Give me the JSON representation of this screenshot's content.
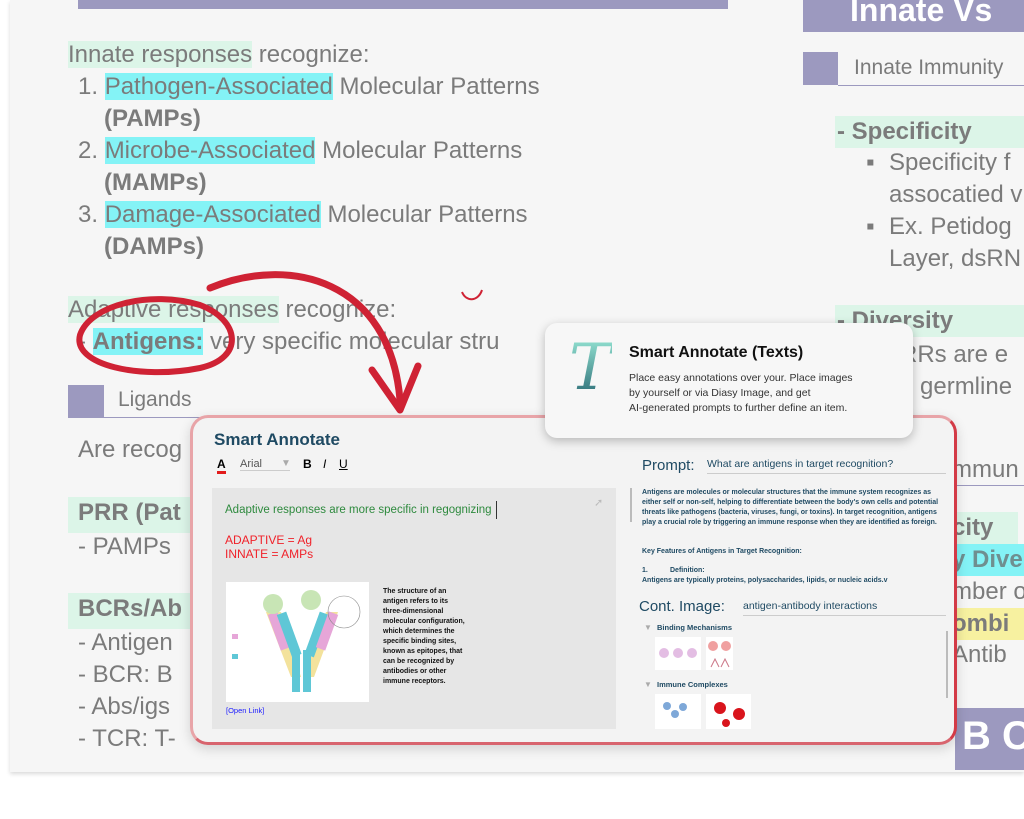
{
  "left": {
    "lines": [
      "Innate responses",
      " recognize:",
      "1. ",
      "Pathogen-Associated",
      " Molecular Patterns",
      "(PAMPs)",
      "2. ",
      "Microbe-Associated",
      " Molecular Patterns",
      "(MAMPs)",
      "3. ",
      "Damage-Associated",
      " Molecular Patterns",
      "(DAMPs)",
      "Adaptive responses",
      " recognize:",
      "-  ",
      "Antigens:",
      " very specific molecular stru"
    ],
    "ligands": "Ligands",
    "are_recog": "Are recog",
    "prr": "PRR (Pat",
    "pamps": "-  PAMPs",
    "bcrs": "BCRs/Ab",
    "items": [
      "-  Antigen",
      "-  BCR: B",
      "-  Abs/igs",
      "-  TCR: T-"
    ]
  },
  "right": {
    "title": "Innate Vs",
    "subtitle": "Innate Immunity",
    "specificity": "-  Specificity",
    "spec_lines": [
      "Specificity f",
      "assocatied v",
      "Ex. Petidog",
      "Layer, dsRN"
    ],
    "diversity": "-  Diversity",
    "div_lines": [
      "RRs are e",
      "germline",
      "mmun",
      "city",
      "y Dive",
      "mber o",
      "ombi",
      "Antib"
    ],
    "bottom": "B C"
  },
  "tooltip": {
    "title": "Smart Annotate (Texts)",
    "body": [
      "Place easy annotations over your. Place images",
      "by yourself or via Diasy Image, and get",
      "AI-generated prompts to further define an item."
    ],
    "logo_letter": "T"
  },
  "panel": {
    "title": "Smart Annotate",
    "font": "Arial",
    "bold": "B",
    "italic": "I",
    "underline": "U",
    "color_label": "A",
    "note_line": "Adaptive responses are more specific in regognizing",
    "note_red": [
      "ADAPTIVE = Ag",
      "INNATE = AMPs"
    ],
    "caption": [
      "The structure of an",
      "antigen refers to its",
      "three-dimensional",
      "molecular configuration,",
      "which determines the",
      "specific binding sites,",
      "known as epitopes, that",
      "can be recognized by",
      "antibodies or other",
      "immune receptors."
    ],
    "open_link": "[Open Link]",
    "prompt_label": "Prompt:",
    "prompt_value": "What are antigens in target recognition?",
    "answer": "Antigens are molecules or molecular structures that the immune system recognizes as either self or non-self, helping to differentiate between the body's own cells and potential threats like pathogens (bacteria, viruses, fungi, or toxins). In target recognition, antigens play a crucial role by triggering an immune response when they are identified as foreign.",
    "key_heading": "Key Features of Antigens in Target Recognition:",
    "def_num": "1.",
    "def_label": "Definition:",
    "def_text": "Antigens are typically proteins, polysaccharides, lipids, or nucleic acids.v",
    "cont_label": "Cont. Image:",
    "cont_value": "antigen-antibody interactions",
    "groups": [
      "Binding Mechanisms",
      "Immune Complexes"
    ]
  },
  "colors": {
    "accent_red": "#d0283a",
    "purple": "#9c99bf",
    "mint": "#dcf5e8",
    "cyan": "#84f3f6",
    "navy": "#1f4a63"
  }
}
